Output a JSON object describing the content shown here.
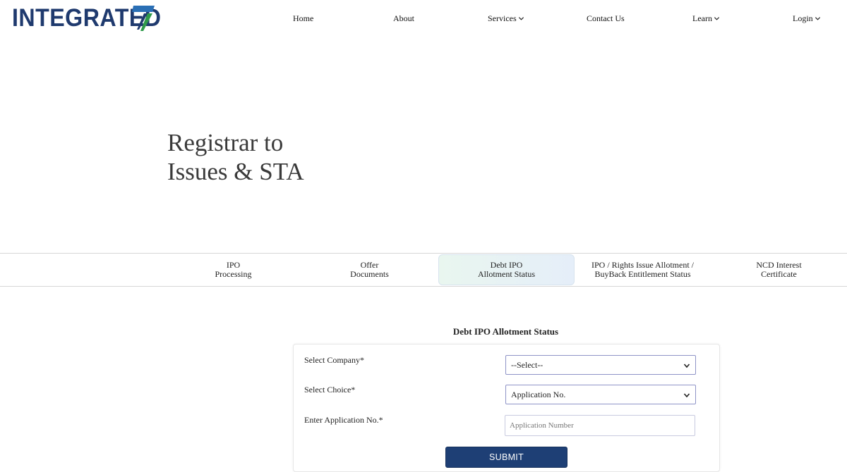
{
  "header": {
    "logo_text": "INTEGRATED",
    "nav": [
      {
        "label": "Home",
        "has_dropdown": false
      },
      {
        "label": "About",
        "has_dropdown": false
      },
      {
        "label": "Services",
        "has_dropdown": true
      },
      {
        "label": "Contact Us",
        "has_dropdown": false
      },
      {
        "label": "Learn",
        "has_dropdown": true
      },
      {
        "label": "Login",
        "has_dropdown": true
      }
    ]
  },
  "hero": {
    "line1": "Registrar to",
    "line2": "Issues & STA"
  },
  "tabs": [
    {
      "line1": "IPO",
      "line2": "Processing",
      "active": false
    },
    {
      "line1": "Offer",
      "line2": "Documents",
      "active": false
    },
    {
      "line1": "Debt IPO",
      "line2": "Allotment Status",
      "active": true
    },
    {
      "line1": "IPO / Rights Issue Allotment /",
      "line2": "BuyBack Entitlement Status",
      "active": false
    },
    {
      "line1": "NCD Interest",
      "line2": "Certificate",
      "active": false
    }
  ],
  "form": {
    "title": "Debt IPO Allotment Status",
    "company_label": "Select Company*",
    "company_value": "--Select--",
    "choice_label": "Select Choice*",
    "choice_value": "Application No.",
    "appno_label": "Enter Application No.*",
    "appno_placeholder": "Application Number",
    "submit_label": "SUBMIT"
  },
  "colors": {
    "brand_navy": "#1f3a6e",
    "logo_blue": "#2a6fb5",
    "logo_green": "#2e9a4a",
    "submit_bg": "#1e3f75"
  }
}
